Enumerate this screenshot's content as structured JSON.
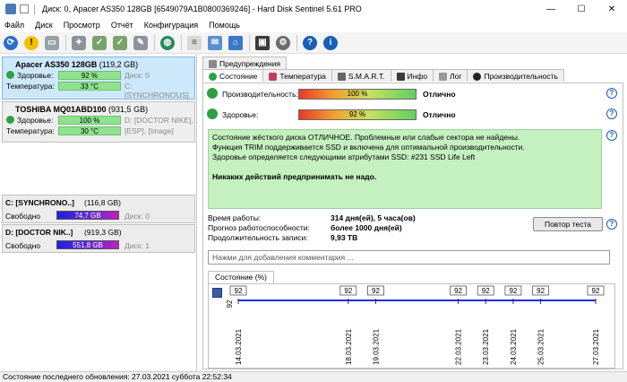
{
  "window": {
    "title": "Диск: 0, Apacer AS350 128GB [6549079A1B0800369246]  -  Hard Disk Sentinel 5.61 PRO",
    "minimize": "—",
    "maximize": "☐",
    "close": "✕"
  },
  "menu": [
    "Файл",
    "Диск",
    "Просмотр",
    "Отчёт",
    "Конфигурация",
    "Помощь"
  ],
  "toolbar_icons": [
    "refresh-icon",
    "alert-icon",
    "disk-info-icon",
    "disk-check-icon",
    "disk-ok-icon",
    "disk-ok2-icon",
    "disk-settings-icon",
    "globe-icon",
    "report-icon",
    "report-send-icon",
    "network-icon",
    "monitor-icon",
    "settings-icon",
    "help-icon",
    "info-icon"
  ],
  "disks": [
    {
      "name": "Apacer AS350 128GB",
      "size": "(119,2 GB)",
      "health_label": "Здоровье:",
      "health": "92 %",
      "health_pct": 92,
      "disk_id": "Диск: 0",
      "temp_label": "Температура:",
      "temp": "33 °C",
      "volumes": "C: [SYNCHRONOUS]",
      "selected": true
    },
    {
      "name": "TOSHIBA MQ01ABD100",
      "size": "(931,5 GB)",
      "health_label": "Здоровье:",
      "health": "100 %",
      "health_pct": 100,
      "disk_id": "D: [DOCTOR NIKE],",
      "temp_label": "Температура:",
      "temp": "30 °C",
      "volumes": "[ESP],  [Image]",
      "selected": false
    }
  ],
  "volumes": [
    {
      "name": "C: [SYNCHRONO..]",
      "size": "(116,8 GB)",
      "free_label": "Свободно",
      "free": "74,7 GB",
      "disk": "Диск: 0"
    },
    {
      "name": "D: [DOCTOR NIK..]",
      "size": "(919,3 GB)",
      "free_label": "Свободно",
      "free": "551,8 GB",
      "disk": "Диск: 1"
    }
  ],
  "tabs_top": [
    "Предупреждения"
  ],
  "tabs": [
    "Состояние",
    "Температура",
    "S.M.A.R.T.",
    "Инфо",
    "Лог",
    "Производительность"
  ],
  "status": {
    "performance_label": "Производительность:",
    "performance": "100 %",
    "performance_pct": 100,
    "performance_text": "Отлично",
    "health_label": "Здоровье:",
    "health": "92 %",
    "health_pct": 92,
    "health_text": "Отлично"
  },
  "info": {
    "line1": "Состояние жёсткого диска ОТЛИЧНОЕ. Проблемные или слабые сектора не найдены.",
    "line2": "Функция TRIM поддерживается SSD и включена для оптимальной производительности.",
    "line3": "Здоровье определяется следующими атрибутами SSD: #231 SSD Life Left",
    "line4": "Никаких действий предпринимать не надо."
  },
  "stats": [
    {
      "k": "Время работы:",
      "v": "314 дня(ей), 5 часа(ов)"
    },
    {
      "k": "Прогноз работоспособности:",
      "v": "более 1000 дня(ей)"
    },
    {
      "k": "Продолжительность записи:",
      "v": "9,93 TB"
    }
  ],
  "retest_button": "Повтор теста",
  "comment_placeholder": "Нажми для добавления комментария ...",
  "chart_tab": "Состояние (%)",
  "chart_data": {
    "type": "line",
    "x": [
      "14.03.2021",
      "18.03.2021",
      "19.03.2021",
      "22.03.2021",
      "23.03.2021",
      "24.03.2021",
      "25.03.2021",
      "27.03.2021"
    ],
    "values": [
      92,
      92,
      92,
      92,
      92,
      92,
      92,
      92
    ],
    "y_tick": "92",
    "line_color": "#1a2ee0"
  },
  "statusbar": "Состояние последнего обновления: 27.03.2021 суббота 22:52:34"
}
